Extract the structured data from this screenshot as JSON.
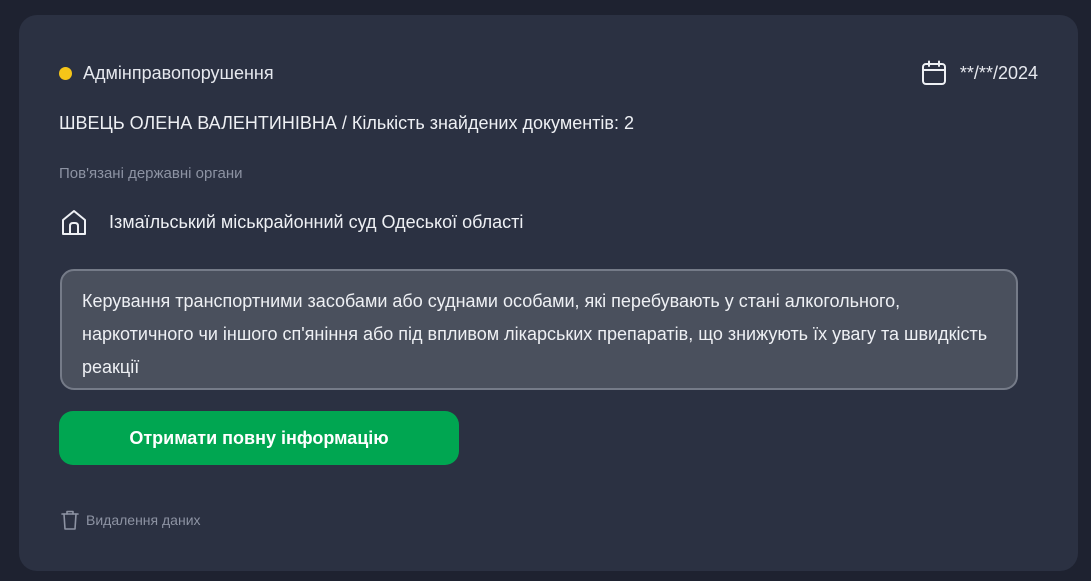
{
  "colors": {
    "background": "#1e2230",
    "card": "#2b3142",
    "status_dot": "#f5c518",
    "button": "#00a651",
    "text_box": "#4a505d"
  },
  "header": {
    "category": "Адмінправопорушення",
    "date": "**/**/2024",
    "calendar_icon": "calendar-icon"
  },
  "person": {
    "line": "ШВЕЦЬ ОЛЕНА ВАЛЕНТИНІВНА / Кількість знайдених документів: 2"
  },
  "related_bodies": {
    "label": "Пов'язані державні органи",
    "icon": "home-icon",
    "court": "Ізмаїльський міськрайонний суд Одеської області"
  },
  "description": {
    "text": "Керування транспортними засобами або суднами особами, які перебувають у стані алкогольного, наркотичного чи іншого сп'яніння або під впливом лікарських препаратів, що знижують їх увагу та швидкість реакції"
  },
  "actions": {
    "get_info_label": "Отримати повну інформацію",
    "delete_label": "Видалення даних",
    "delete_icon": "trash-icon"
  }
}
